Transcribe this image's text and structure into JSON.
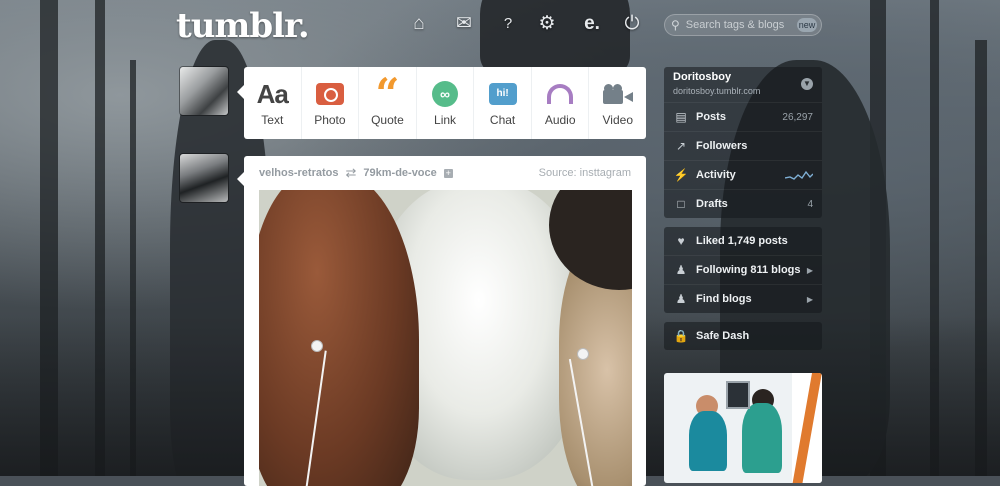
{
  "header": {
    "logo": "tumblr.",
    "nav_icons": [
      "home-icon",
      "inbox-icon",
      "help-icon",
      "gear-icon",
      "explore-icon",
      "power-icon"
    ],
    "search_placeholder": "Search tags & blogs",
    "search_badge": "new"
  },
  "post_types": [
    {
      "label": "Text",
      "icon": "Aa"
    },
    {
      "label": "Photo",
      "icon": "photo-icon",
      "color": "#d95e40"
    },
    {
      "label": "Quote",
      "icon": "“",
      "color": "#f2992e"
    },
    {
      "label": "Link",
      "icon": "link-icon",
      "color": "#56bc8a"
    },
    {
      "label": "Chat",
      "icon": "hi!",
      "color": "#529ecc"
    },
    {
      "label": "Audio",
      "icon": "headphones-icon",
      "color": "#a77dc2"
    },
    {
      "label": "Video",
      "icon": "video-camera-icon",
      "color": "#748089"
    }
  ],
  "post": {
    "reblogged_from": "velhos-retratos",
    "blog": "79km-de-voce",
    "source": "Source: insttagram"
  },
  "sidebar": {
    "user": {
      "name": "Doritosboy",
      "url": "doritosboy.tumblr.com"
    },
    "stats": [
      {
        "label": "Posts",
        "icon": "posts-icon",
        "count": "26,297"
      },
      {
        "label": "Followers",
        "icon": "followers-icon",
        "count": ""
      },
      {
        "label": "Activity",
        "icon": "activity-icon",
        "count": ""
      },
      {
        "label": "Drafts",
        "icon": "drafts-icon",
        "count": "4"
      }
    ],
    "links": [
      {
        "label": "Liked 1,749 posts",
        "icon": "heart-icon"
      },
      {
        "label": "Following 811 blogs",
        "icon": "user-icon"
      },
      {
        "label": "Find blogs",
        "icon": "add-user-icon"
      }
    ],
    "safe": {
      "label": "Safe Dash",
      "icon": "lock-icon"
    }
  }
}
